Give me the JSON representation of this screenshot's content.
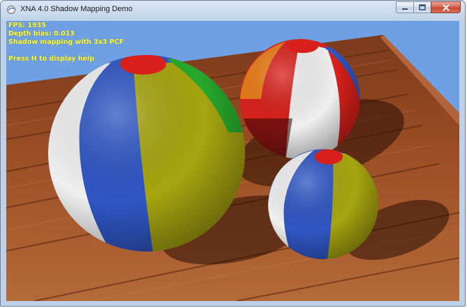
{
  "window": {
    "title": "XNA 4.0 Shadow Mapping Demo"
  },
  "hud": {
    "fps": "FPS: 1935",
    "depth_bias": "Depth bias: 0.013",
    "shadow_mode": "Shadow mapping with 3x3 PCF",
    "help_hint": "Press H to display help"
  },
  "colors": {
    "sky": "#6ea0e3",
    "hud_text": "#ffff33",
    "ball_blue": "#2f56c4",
    "ball_yellow": "#a7a510",
    "ball_red": "#d8201a",
    "ball_green": "#27a82c",
    "ball_white": "#f0f0f0",
    "ball_orange": "#ea7a16",
    "wood": "#a0522d"
  },
  "icons": {
    "app": "app-icon",
    "minimize": "minimize-icon",
    "maximize": "maximize-icon",
    "close": "close-icon"
  }
}
